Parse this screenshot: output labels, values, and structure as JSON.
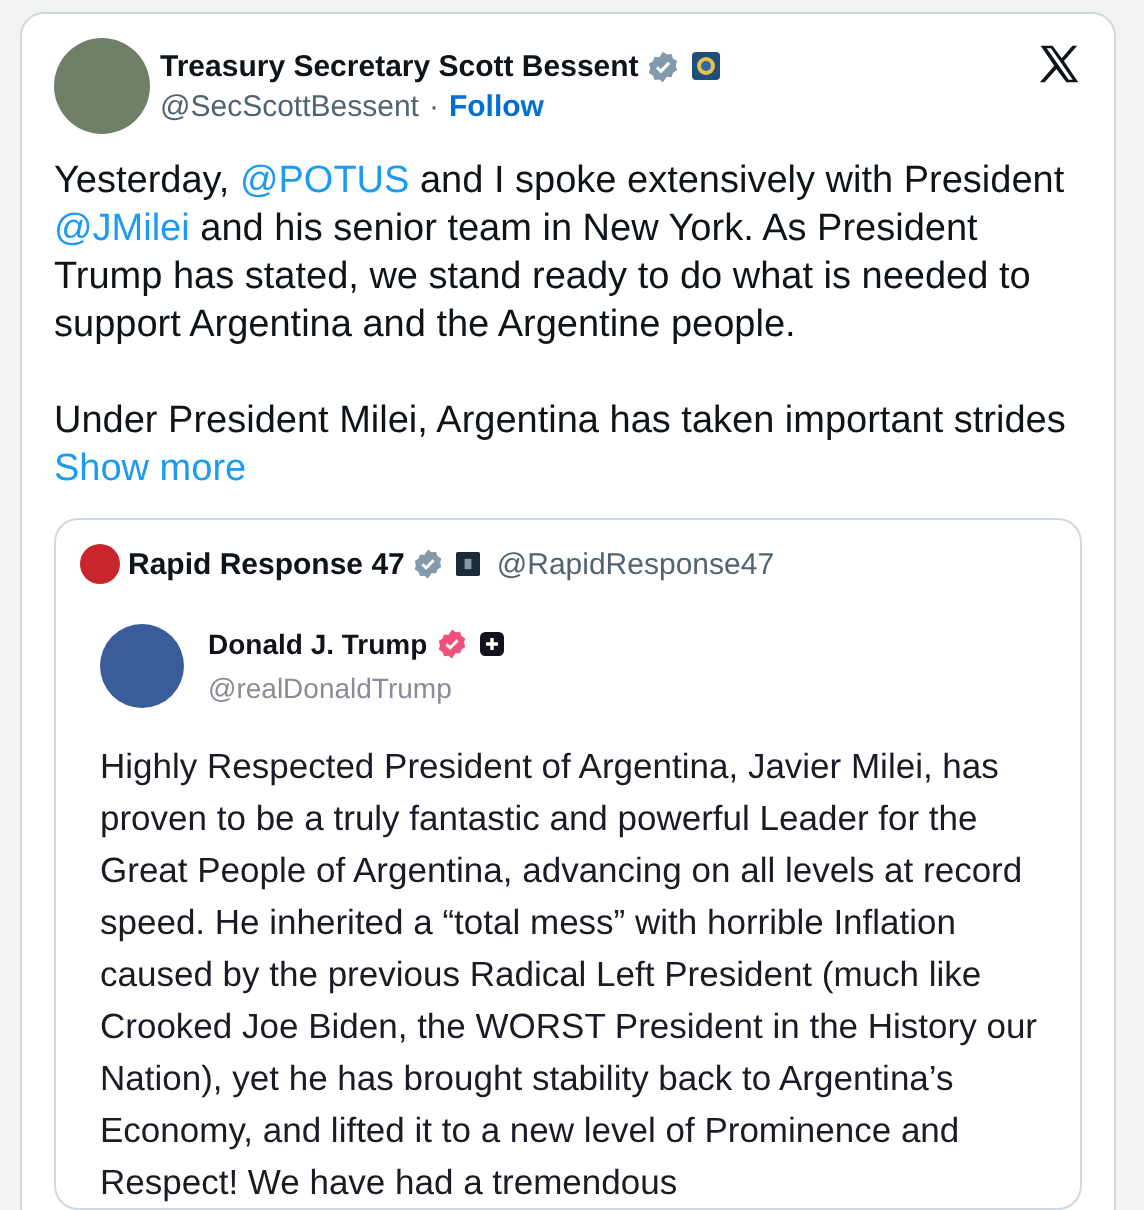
{
  "author": {
    "name": "Treasury Secretary Scott Bessent",
    "handle": "@SecScottBessent",
    "separator": "·",
    "follow": "Follow"
  },
  "paragraphs": [
    [
      {
        "kind": "text",
        "text": "Yesterday, "
      },
      {
        "kind": "link",
        "text": "@POTUS"
      },
      {
        "kind": "text",
        "text": " and I spoke extensively with President "
      },
      {
        "kind": "link",
        "text": "@JMilei"
      },
      {
        "kind": "text",
        "text": " and his senior team in New York.  As President Trump has stated, we stand ready to do what is needed to support Argentina and the Argentine people."
      }
    ],
    [
      {
        "kind": "text",
        "text": "Under President Milei, Argentina has taken important strides "
      },
      {
        "kind": "link",
        "text": "Show more"
      }
    ]
  ],
  "quote": {
    "name": "Rapid Response 47",
    "handle": "@RapidResponse47",
    "post": {
      "name": "Donald J. Trump",
      "handle": "@realDonaldTrump",
      "text": "Highly Respected President of Argentina, Javier Milei, has proven to be a truly fantastic and powerful Leader for the Great People of Argentina, advancing on all levels at record speed. He inherited a “total mess” with horrible Inflation caused by the previous Radical Left President (much like Crooked Joe Biden, the WORST President in the History our Nation), yet he has brought stability back to Argentina’s Economy, and lifted it to a new level of Prominence and Respect! We have had a tremendous"
    }
  }
}
